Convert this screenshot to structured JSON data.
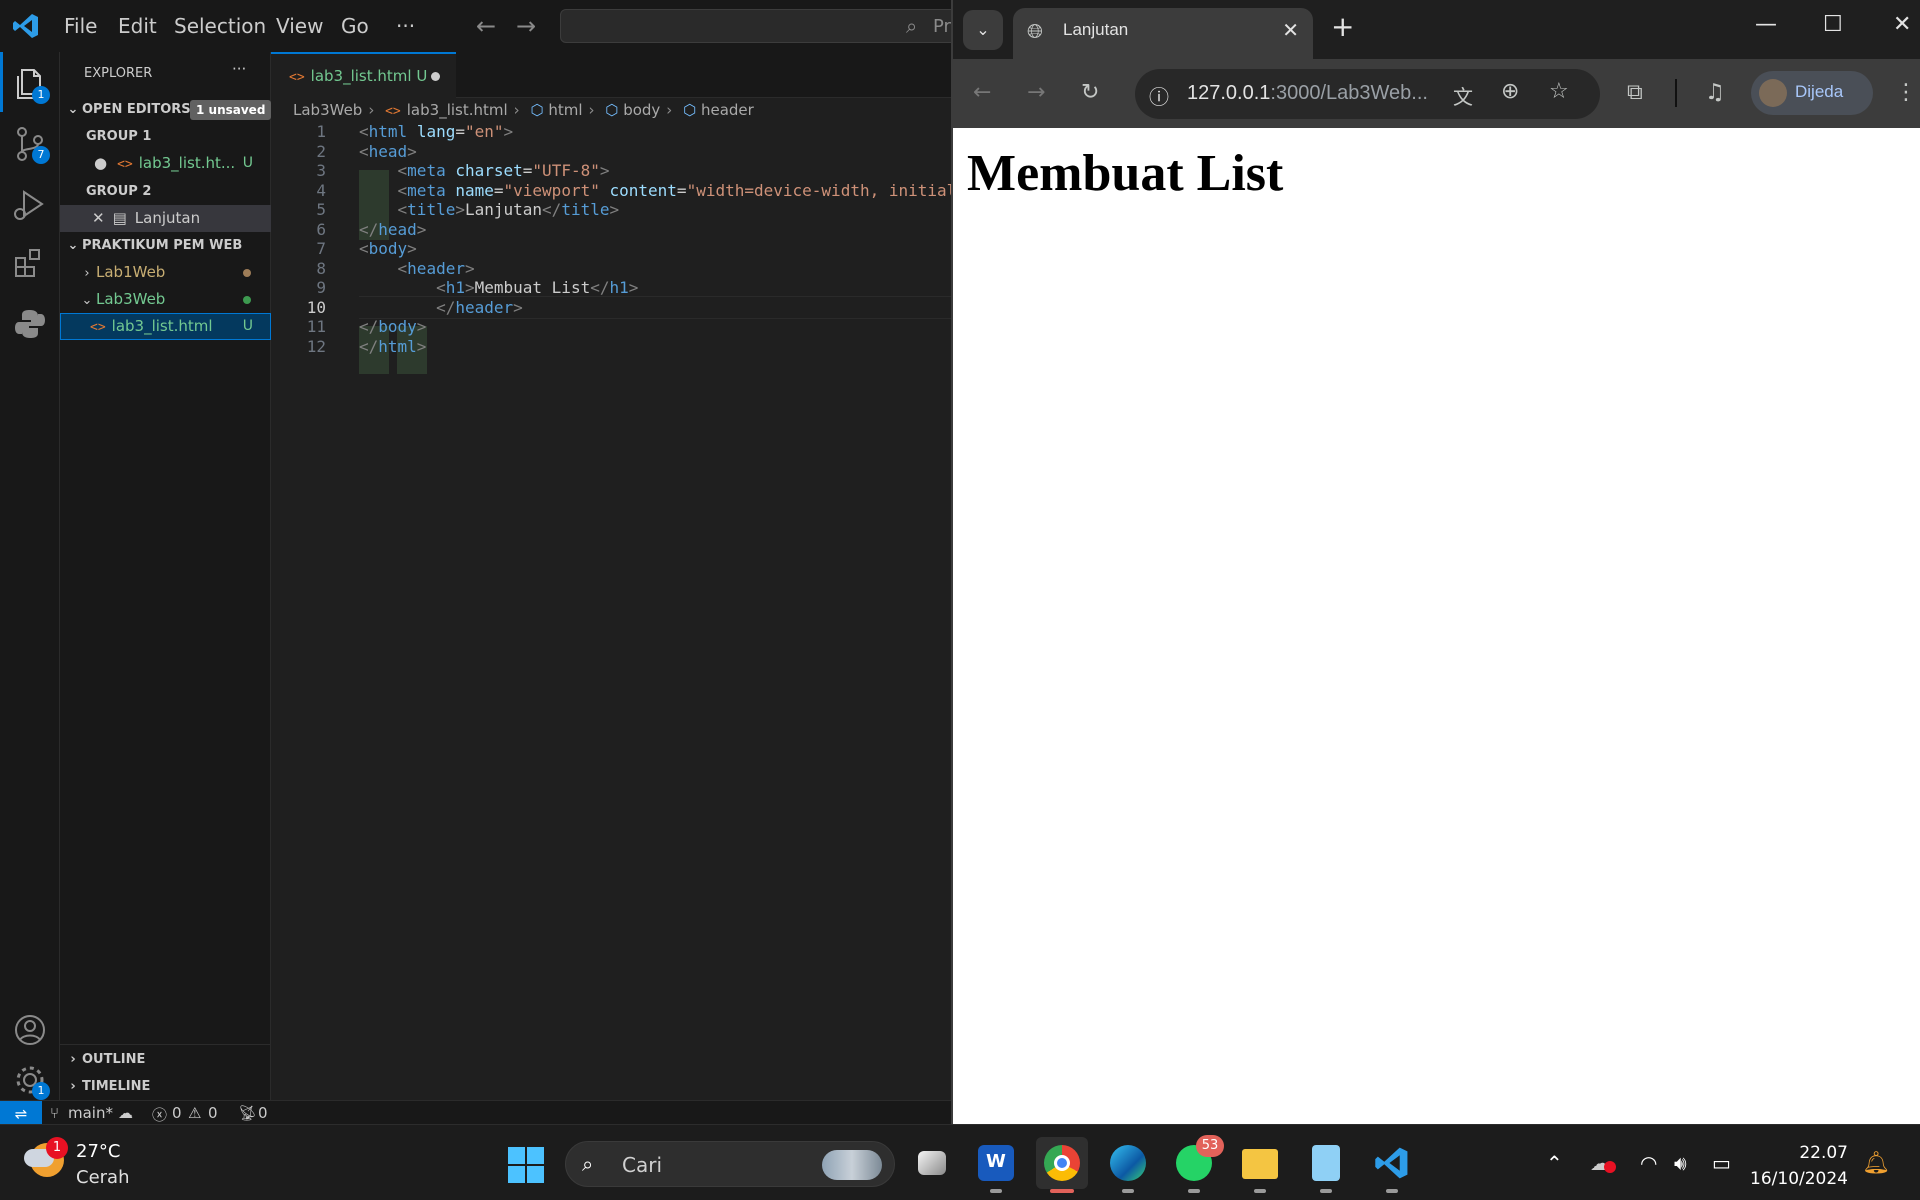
{
  "vscode": {
    "menu": [
      "File",
      "Edit",
      "Selection",
      "View",
      "Go",
      "···"
    ],
    "search_placeholder_partial": "Pr",
    "activity": {
      "explorer_badge": "1",
      "scm_badge": "7",
      "settings_badge": "1"
    },
    "sidebar": {
      "title": "EXPLORER",
      "more": "···",
      "open_editors": "OPEN EDITORS",
      "unsaved_badge": "1 unsaved",
      "group1": "GROUP 1",
      "group1_file": "lab3_list.ht...",
      "group1_file_status": "U",
      "group2": "GROUP 2",
      "group2_file": "Lanjutan",
      "workspace": "PRAKTIKUM PEM WEB",
      "folders": [
        {
          "name": "Lab1Web",
          "color": "#c8ae73",
          "dot": "#9e7d58"
        },
        {
          "name": "Lab3Web",
          "color": "#73c991",
          "dot": "#3d9a50"
        }
      ],
      "active_file": "lab3_list.html",
      "active_file_status": "U",
      "outline": "OUTLINE",
      "timeline": "TIMELINE"
    },
    "tab": {
      "label": "lab3_list.html",
      "status": "U"
    },
    "breadcrumb": [
      "Lab3Web",
      "lab3_list.html",
      "html",
      "body",
      "header"
    ],
    "code_lines": [
      {
        "n": "1",
        "html": "<span class='tb'>&lt;</span><span class='tg'>html</span> <span class='at'>lang</span>=<span class='sv'>\"en\"</span><span class='tb'>&gt;</span>"
      },
      {
        "n": "2",
        "html": "<span class='tb'>&lt;</span><span class='tg'>head</span><span class='tb'>&gt;</span>"
      },
      {
        "n": "3",
        "html": "    <span class='tb'>&lt;</span><span class='tg'>meta</span> <span class='at'>charset</span>=<span class='sv'>\"UTF-8\"</span><span class='tb'>&gt;</span>"
      },
      {
        "n": "4",
        "html": "    <span class='tb'>&lt;</span><span class='tg'>meta</span> <span class='at'>name</span>=<span class='sv'>\"viewport\"</span> <span class='at'>content</span>=<span class='sv'>\"width=device-width, initial</span>"
      },
      {
        "n": "5",
        "html": "    <span class='tb'>&lt;</span><span class='tg'>title</span><span class='tb'>&gt;</span>Lanjutan<span class='tb'>&lt;/</span><span class='tg'>title</span><span class='tb'>&gt;</span>"
      },
      {
        "n": "6",
        "html": "<span class='tb'>&lt;/</span><span class='tg'>head</span><span class='tb'>&gt;</span>"
      },
      {
        "n": "7",
        "html": "<span class='tb'>&lt;</span><span class='tg'>body</span><span class='tb'>&gt;</span>"
      },
      {
        "n": "8",
        "html": "    <span class='tb'>&lt;</span><span class='tg'>header</span><span class='tb'>&gt;</span>"
      },
      {
        "n": "9",
        "html": "        <span class='tb'>&lt;</span><span class='tg'>h1</span><span class='tb'>&gt;</span>Membuat List<span class='tb'>&lt;/</span><span class='tg'>h1</span><span class='tb'>&gt;</span>"
      },
      {
        "n": "10",
        "html": "        <span class='tb'>&lt;/</span><span class='tg'>header</span><span class='tb'>&gt;</span>"
      },
      {
        "n": "11",
        "html": "<span class='tb'>&lt;/</span><span class='tg'>body</span><span class='tb'>&gt;</span>"
      },
      {
        "n": "12",
        "html": "<span class='tb'>&lt;/</span><span class='tg'>html</span><span class='tb'>&gt;</span>"
      }
    ],
    "current_line": "10",
    "status": {
      "branch": "main*",
      "errors": "0",
      "warnings": "0",
      "ports": "0"
    }
  },
  "chrome": {
    "tab_title": "Lanjutan",
    "url_host": "127.0.0.1",
    "url_rest": ":3000/Lab3Web...",
    "profile_name": "Dijeda",
    "page_heading": "Membuat List"
  },
  "taskbar": {
    "weather_temp": "27°C",
    "weather_cond": "Cerah",
    "weather_badge": "1",
    "search_text": "Cari",
    "whatsapp_badge": "53",
    "time": "22.07",
    "date": "16/10/2024"
  }
}
